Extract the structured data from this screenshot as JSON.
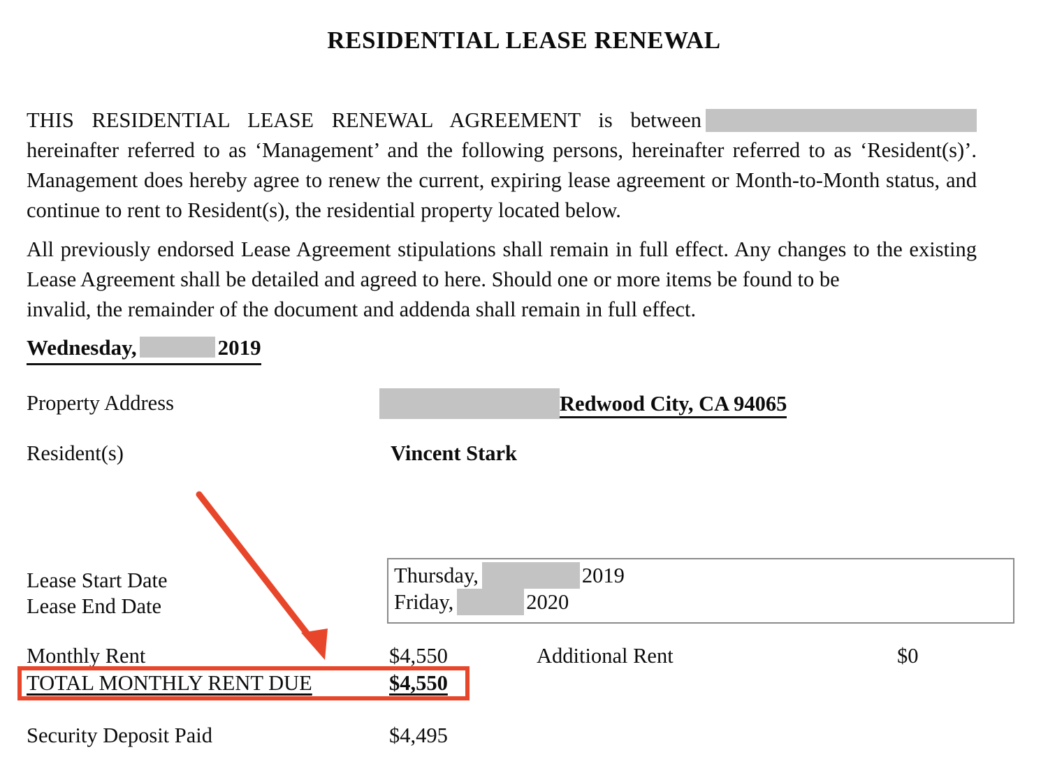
{
  "document": {
    "title": "RESIDENTIAL LEASE RENEWAL",
    "paragraphs": {
      "intro_before_redaction": "THIS RESIDENTIAL LEASE RENEWAL AGREEMENT is between",
      "intro_after_redaction": "hereinafter referred to as ‘Management’ and the following persons, hereinafter referred to as ‘Resident(s)’.  Management does hereby agree to renew the current, expiring lease agreement or Month-to-Month status, and continue to rent to Resident(s), the residential property located below.",
      "stipulations_main": "All previously endorsed Lease Agreement stipulations shall remain in full effect.  Any changes to the existing Lease Agreement shall be detailed and agreed to here.  Should one or more items be found to be",
      "stipulations_last_line": "invalid, the remainder of the document and addenda shall remain in full effect."
    },
    "date_line": {
      "weekday": "Wednesday,",
      "year": "2019",
      "redacted": true
    },
    "fields": [
      {
        "label": "Property Address",
        "value_redacted": true,
        "value": "Redwood City, CA 94065",
        "bold": true,
        "underlined": true
      },
      {
        "label": "Resident(s)",
        "value_redacted": false,
        "value": "Vincent Stark",
        "bold": true,
        "underlined": false
      }
    ],
    "lease_terms": {
      "start_label": "Lease Start Date",
      "end_label": "Lease End Date",
      "start_weekday": "Thursday,",
      "start_year": "2019",
      "end_weekday": "Friday,",
      "end_year": "2020"
    },
    "money_rows": {
      "monthly_rent_label": "Monthly Rent",
      "monthly_rent_amount": "$4,550",
      "additional_rent_label": "Additional Rent",
      "additional_rent_amount": "$0",
      "total_label": "TOTAL MONTHLY RENT DUE",
      "total_amount": "$4,550",
      "deposit_label": "Security Deposit Paid",
      "deposit_amount": "$4,495"
    },
    "annotations": {
      "arrow_color": "#e8462a",
      "highlight_color": "#e8462a",
      "arrow_target": "TOTAL MONTHLY RENT DUE",
      "highlight_target": "TOTAL MONTHLY RENT DUE"
    },
    "colors": {
      "redaction": "#c3c3c3",
      "text": "#0c0c0c",
      "box_border": "#8a8a8a",
      "background": "#ffffff"
    }
  }
}
